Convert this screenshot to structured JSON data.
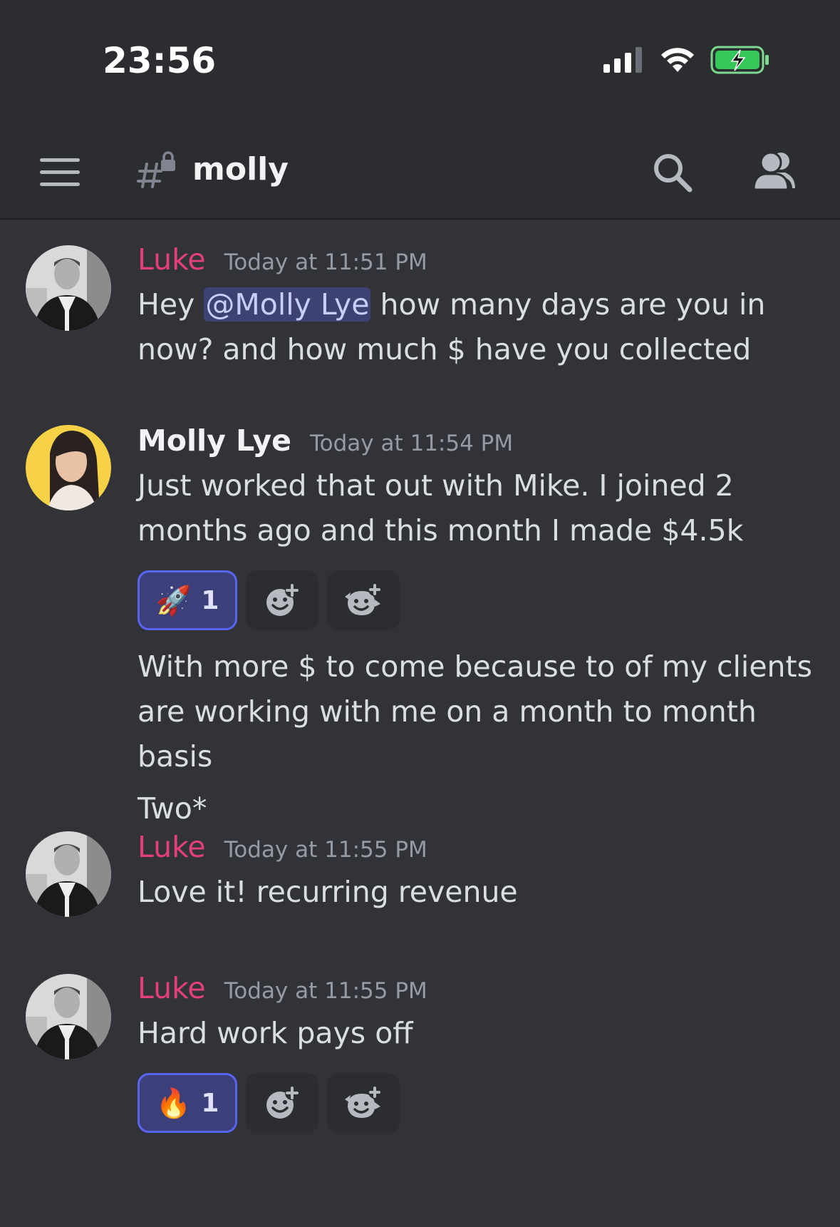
{
  "status_bar": {
    "time": "23:56",
    "icons": [
      "signal-icon",
      "wifi-icon",
      "battery-charging-icon"
    ]
  },
  "header": {
    "channel_name": "molly",
    "channel_icon": "private-channel-icon",
    "menu_icon": "hamburger-icon",
    "search_icon": "search-icon",
    "members_icon": "members-icon"
  },
  "messages": [
    {
      "author": "Luke",
      "timestamp": "Today at 11:51 PM",
      "text_before_mention": "Hey ",
      "mention": "@Molly Lye",
      "text_after_mention": " how many days are you in now? and how much $ have you collected"
    },
    {
      "author": "Molly Lye",
      "timestamp": "Today at 11:54 PM",
      "text": "Just worked that out with Mike. I joined 2 months ago and this month I made $4.5k",
      "reaction": {
        "emoji": "🚀",
        "count": "1"
      },
      "followups": [
        "With more $ to come because to of my clients are working with me on a month to month basis",
        "Two*"
      ]
    },
    {
      "author": "Luke",
      "timestamp": "Today at 11:55 PM",
      "text": "Love it! recurring revenue"
    },
    {
      "author": "Luke",
      "timestamp": "Today at 11:55 PM",
      "text": "Hard work pays off",
      "reaction": {
        "emoji": "🔥",
        "count": "1"
      }
    }
  ],
  "colors": {
    "background": "#313338",
    "header_bg": "#2b2d31",
    "luke_name": "#e43f79",
    "mention_bg": "#3e4273",
    "reaction_active_border": "#5865f2"
  }
}
